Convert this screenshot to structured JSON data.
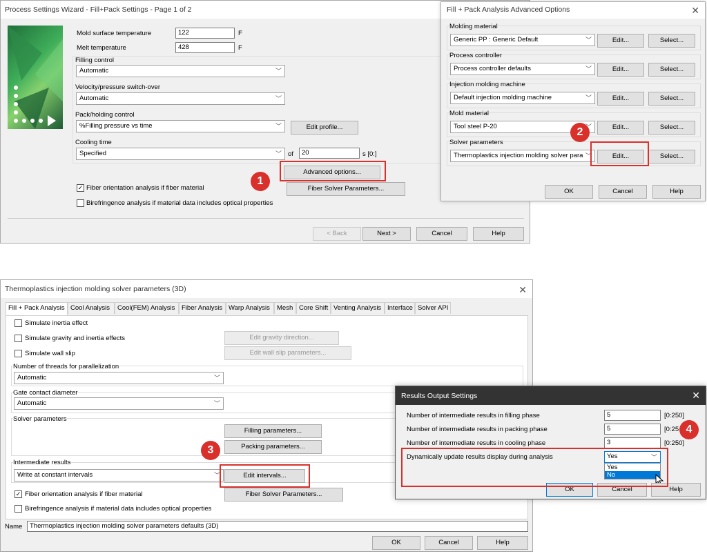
{
  "wizard": {
    "title": "Process Settings Wizard - Fill+Pack Settings - Page 1 of 2",
    "mold_surface_temp_label": "Mold surface temperature",
    "mold_surface_temp_value": "122",
    "mold_surface_temp_unit": "F",
    "melt_temp_label": "Melt temperature",
    "melt_temp_value": "428",
    "melt_temp_unit": "F",
    "filling_control_label": "Filling control",
    "filling_control_value": "Automatic",
    "switchover_label": "Velocity/pressure switch-over",
    "switchover_value": "Automatic",
    "pack_control_label": "Pack/holding control",
    "pack_control_value": "%Filling pressure vs time",
    "edit_profile": "Edit profile...",
    "cooling_time_label": "Cooling time",
    "cooling_time_mode": "Specified",
    "of_label": "of",
    "cooling_time_value": "20",
    "cooling_time_unit": "s [0:]",
    "advanced_options": "Advanced options...",
    "fiber_solver_params": "Fiber Solver Parameters...",
    "fiber_orientation": "Fiber orientation analysis if fiber material",
    "birefringence": "Birefringence analysis if material data includes optical properties",
    "back": "< Back",
    "next": "Next >",
    "cancel": "Cancel",
    "help": "Help"
  },
  "advanced": {
    "title": "Fill + Pack Analysis Advanced Options",
    "rows": [
      {
        "label": "Molding material",
        "value": "Generic PP : Generic Default",
        "edit": "Edit...",
        "select": "Select..."
      },
      {
        "label": "Process controller",
        "value": "Process controller defaults",
        "edit": "Edit...",
        "select": "Select..."
      },
      {
        "label": "Injection molding machine",
        "value": "Default injection molding machine",
        "edit": "Edit...",
        "select": "Select..."
      },
      {
        "label": "Mold material",
        "value": "Tool steel P-20",
        "edit": "Edit...",
        "select": "Select..."
      },
      {
        "label": "Solver parameters",
        "value": "Thermoplastics injection molding solver para",
        "edit": "Edit...",
        "select": "Select..."
      }
    ],
    "ok": "OK",
    "cancel": "Cancel",
    "help": "Help"
  },
  "solver": {
    "title": "Thermoplastics injection molding solver parameters (3D)",
    "tabs": [
      "Fill + Pack Analysis",
      "Cool Analysis",
      "Cool(FEM) Analysis",
      "Fiber Analysis",
      "Warp Analysis",
      "Mesh",
      "Core Shift",
      "Venting Analysis",
      "Interface",
      "Solver API"
    ],
    "simulate_inertia": "Simulate inertia effect",
    "simulate_gravity": "Simulate gravity and inertia effects",
    "edit_gravity": "Edit gravity direction...",
    "simulate_wall_slip": "Simulate wall slip",
    "edit_wall_slip": "Edit wall slip parameters...",
    "threads_label": "Number of threads for parallelization",
    "threads_value": "Automatic",
    "gate_label": "Gate contact diameter",
    "gate_value": "Automatic",
    "solver_params_label": "Solver parameters",
    "filling_params": "Filling parameters...",
    "packing_params": "Packing parameters...",
    "intermediate_label": "Intermediate results",
    "intermediate_value": "Write at constant intervals",
    "edit_intervals": "Edit intervals...",
    "fiber_orientation": "Fiber orientation analysis if fiber material",
    "fiber_solver_params": "Fiber Solver Parameters...",
    "birefringence": "Birefringence analysis if material data includes optical properties",
    "name_label": "Name",
    "name_value": "Thermoplastics injection molding solver parameters defaults (3D)",
    "ok": "OK",
    "cancel": "Cancel",
    "help": "Help"
  },
  "results": {
    "title": "Results Output Settings",
    "filling_label": "Number of intermediate results in filling phase",
    "filling_value": "5",
    "filling_range": "[0:250]",
    "packing_label": "Number of intermediate results in packing phase",
    "packing_value": "5",
    "packing_range": "[0:25",
    "cooling_label": "Number of intermediate results in cooling phase",
    "cooling_value": "3",
    "cooling_range": "[0:250]",
    "dynamic_label": "Dynamically update results display during analysis",
    "dynamic_value": "Yes",
    "dynamic_options": [
      "Yes",
      "No"
    ],
    "ok": "OK",
    "cancel": "Cancel",
    "help": "Help"
  },
  "callouts": [
    "1",
    "2",
    "3",
    "4"
  ]
}
